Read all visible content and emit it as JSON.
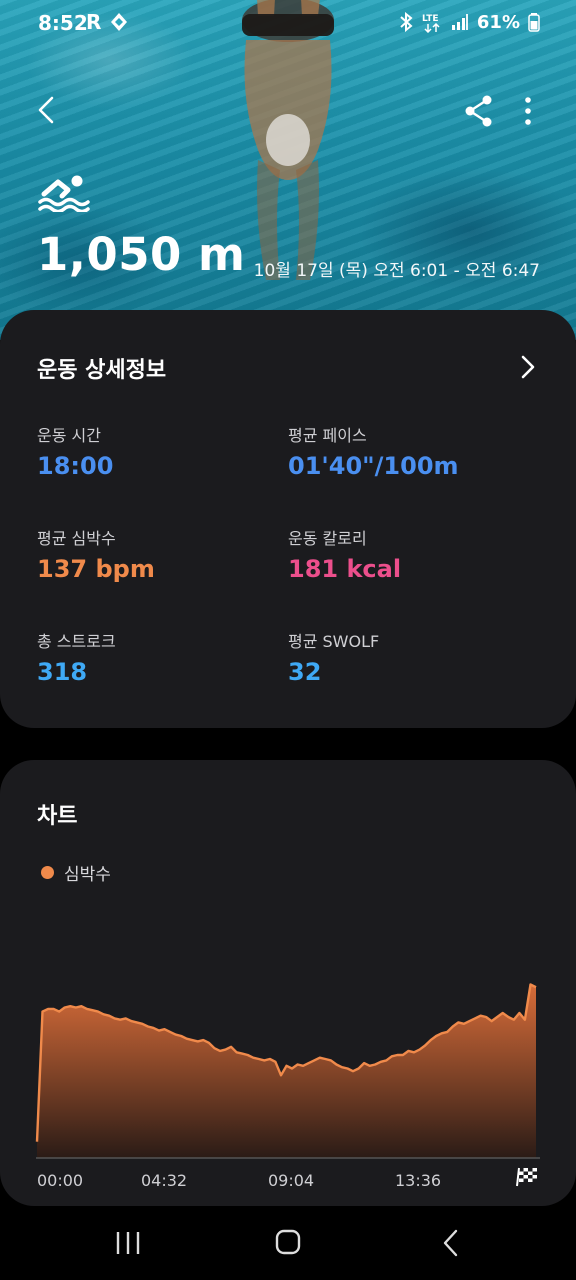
{
  "status_bar": {
    "time": "8:52",
    "carrier_glyph": "R",
    "network": "LTE",
    "battery": "61%"
  },
  "header": {
    "distance": "1,050 m",
    "datetime": "10월 17일 (목) 오전 6:01 - 오전 6:47",
    "activity_icon": "swimming-icon"
  },
  "details": {
    "title": "운동 상세정보",
    "stats": [
      {
        "label": "운동 시간",
        "value": "18:00",
        "color": "#4a8ff0"
      },
      {
        "label": "평균 페이스",
        "value": "01'40\"/100m",
        "color": "#4a8ff0"
      },
      {
        "label": "평균 심박수",
        "value": "137 bpm",
        "color": "#f08a4b"
      },
      {
        "label": "운동 칼로리",
        "value": "181 kcal",
        "color": "#ec4f8c"
      },
      {
        "label": "총 스트로크",
        "value": "318",
        "color": "#3fa9f5"
      },
      {
        "label": "평균 SWOLF",
        "value": "32",
        "color": "#3fa9f5"
      }
    ]
  },
  "chart_card": {
    "title": "차트",
    "legend": "심박수"
  },
  "chart_data": {
    "type": "area",
    "series": [
      {
        "name": "심박수",
        "color": "#f08a4b",
        "values": [
          52,
          148,
          150,
          150,
          148,
          151,
          152,
          151,
          152,
          150,
          149,
          148,
          146,
          145,
          143,
          142,
          143,
          141,
          140,
          139,
          137,
          136,
          134,
          135,
          133,
          131,
          130,
          128,
          127,
          126,
          127,
          125,
          121,
          119,
          120,
          122,
          118,
          117,
          116,
          114,
          113,
          112,
          113,
          111,
          101,
          108,
          106,
          109,
          108,
          110,
          112,
          114,
          113,
          112,
          109,
          107,
          106,
          104,
          106,
          110,
          108,
          109,
          111,
          112,
          115,
          116,
          116,
          119,
          118,
          120,
          123,
          127,
          130,
          132,
          133,
          137,
          140,
          139,
          141,
          143,
          145,
          144,
          141,
          144,
          147,
          144,
          142,
          147,
          142,
          168,
          166
        ]
      }
    ],
    "x_ticks": [
      "00:00",
      "04:32",
      "09:04",
      "13:36"
    ],
    "x_range": [
      "00:00",
      "18:00"
    ],
    "ylim": [
      40,
      175
    ],
    "grid": false,
    "legend_position": "top-left"
  },
  "nav": {
    "recent": "recent-apps-icon",
    "home": "home-icon",
    "back": "back-icon"
  }
}
